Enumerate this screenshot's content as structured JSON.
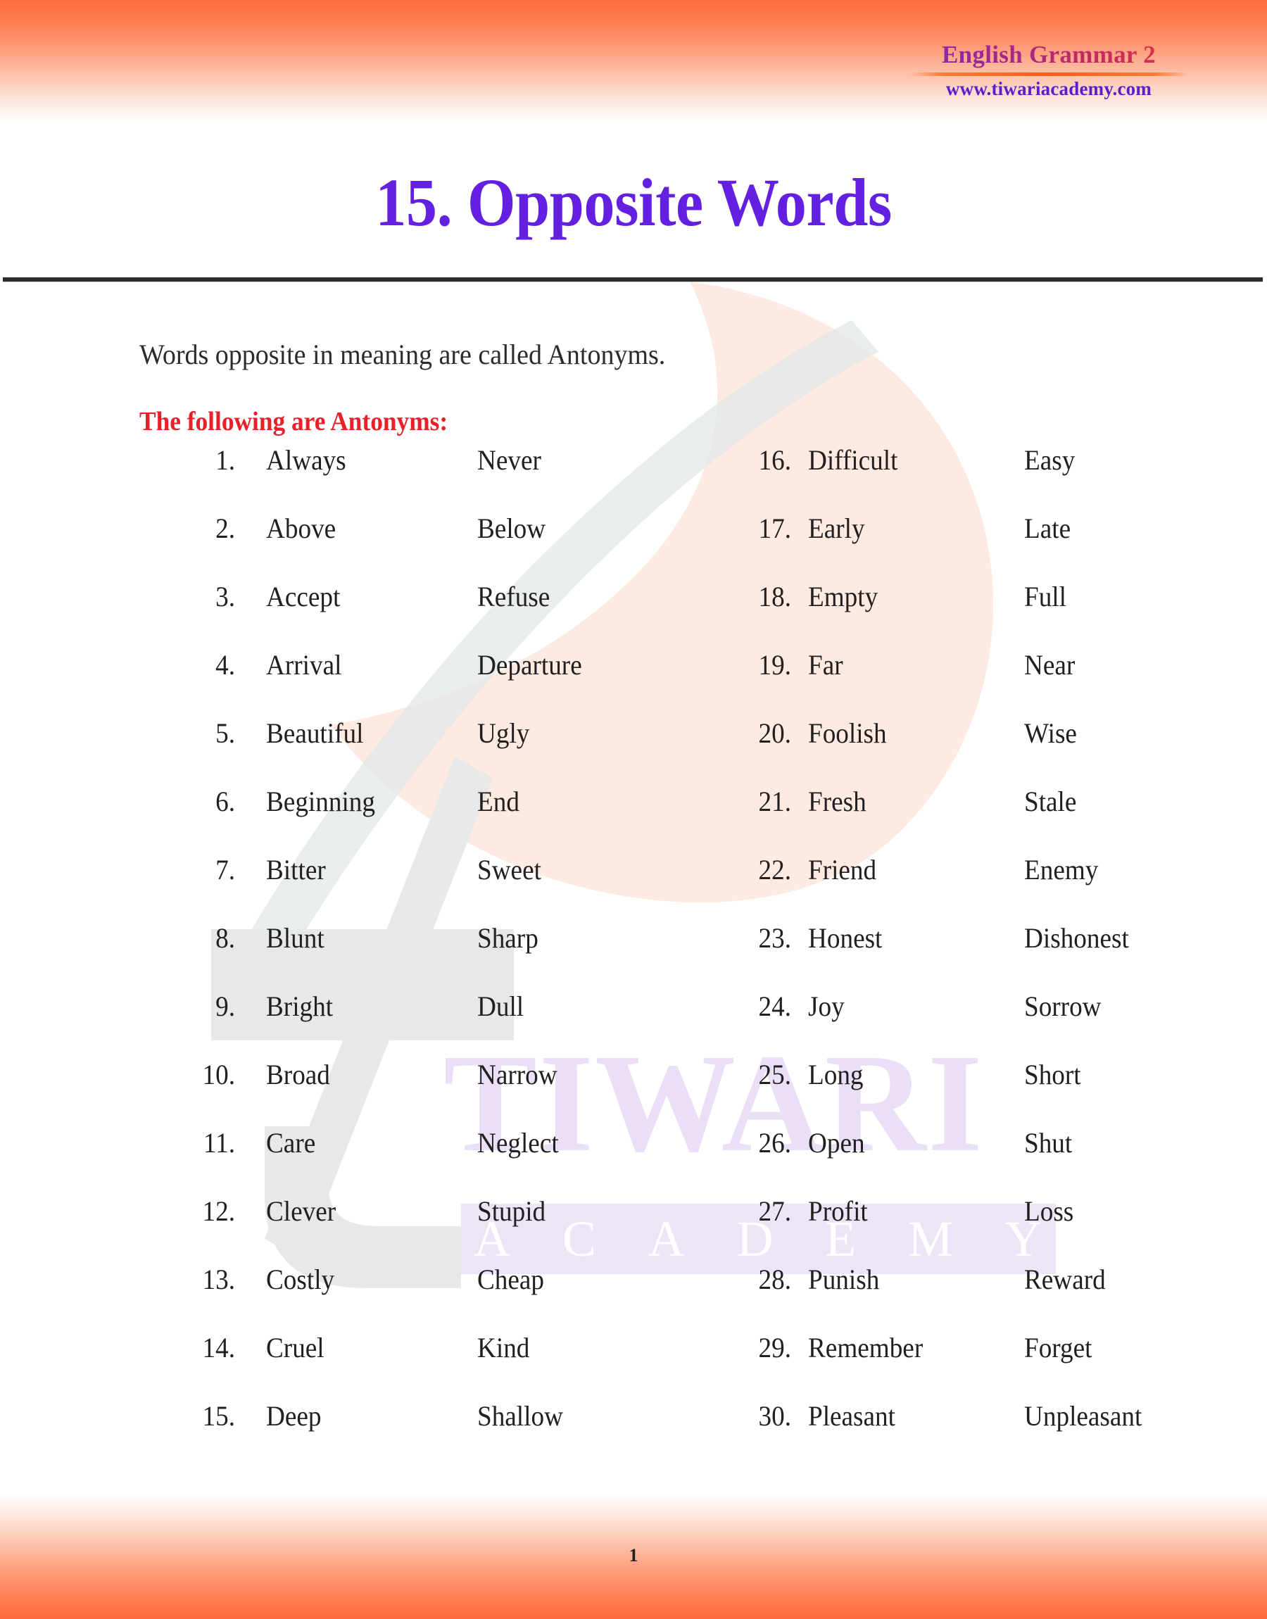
{
  "header": {
    "brand_title": "English Grammar 2",
    "brand_url": "www.tiwariacademy.com"
  },
  "title": "15. Opposite Words",
  "intro": "Words opposite in meaning are called Antonyms.",
  "section_heading": "The following are Antonyms:",
  "footer": {
    "page_number": "1"
  },
  "watermark": {
    "letter": "t",
    "brand": "TIWARI",
    "sub_brand": "ACADEMY",
    "sub_brand_letters": [
      "A",
      "C",
      "A",
      "D",
      "E",
      "M",
      "Y"
    ]
  },
  "colors": {
    "header_orange": "#ff6a3c",
    "title_purple": "#6320e0",
    "section_red": "#e8202a",
    "brand_url_purple": "#5b1ecb",
    "watermark_lavender": "#eadff7",
    "watermark_gray": "#e6e6e6",
    "watermark_peach": "#fdeae0"
  },
  "antonyms": {
    "left_column": [
      {
        "n": "1.",
        "word": "Always",
        "opposite": "Never"
      },
      {
        "n": "2.",
        "word": "Above",
        "opposite": "Below"
      },
      {
        "n": "3.",
        "word": "Accept",
        "opposite": "Refuse"
      },
      {
        "n": "4.",
        "word": "Arrival",
        "opposite": "Departure"
      },
      {
        "n": "5.",
        "word": "Beautiful",
        "opposite": "Ugly"
      },
      {
        "n": "6.",
        "word": "Beginning",
        "opposite": "End"
      },
      {
        "n": "7.",
        "word": "Bitter",
        "opposite": "Sweet"
      },
      {
        "n": "8.",
        "word": "Blunt",
        "opposite": "Sharp"
      },
      {
        "n": "9.",
        "word": "Bright",
        "opposite": "Dull"
      },
      {
        "n": "10.",
        "word": "Broad",
        "opposite": "Narrow"
      },
      {
        "n": "11.",
        "word": "Care",
        "opposite": "Neglect"
      },
      {
        "n": "12.",
        "word": "Clever",
        "opposite": "Stupid"
      },
      {
        "n": "13.",
        "word": "Costly",
        "opposite": "Cheap"
      },
      {
        "n": "14.",
        "word": "Cruel",
        "opposite": "Kind"
      },
      {
        "n": "15.",
        "word": "Deep",
        "opposite": "Shallow"
      }
    ],
    "right_column": [
      {
        "n": "16.",
        "word": "Difficult",
        "opposite": "Easy"
      },
      {
        "n": "17.",
        "word": "Early",
        "opposite": "Late"
      },
      {
        "n": "18.",
        "word": "Empty",
        "opposite": "Full"
      },
      {
        "n": "19.",
        "word": "Far",
        "opposite": "Near"
      },
      {
        "n": "20.",
        "word": "Foolish",
        "opposite": "Wise"
      },
      {
        "n": "21.",
        "word": "Fresh",
        "opposite": "Stale"
      },
      {
        "n": "22.",
        "word": "Friend",
        "opposite": "Enemy"
      },
      {
        "n": "23.",
        "word": "Honest",
        "opposite": "Dishonest"
      },
      {
        "n": "24.",
        "word": "Joy",
        "opposite": "Sorrow"
      },
      {
        "n": "25.",
        "word": "Long",
        "opposite": "Short"
      },
      {
        "n": "26.",
        "word": "Open",
        "opposite": "Shut"
      },
      {
        "n": "27.",
        "word": "Profit",
        "opposite": "Loss"
      },
      {
        "n": "28.",
        "word": "Punish",
        "opposite": "Reward"
      },
      {
        "n": "29.",
        "word": "Remember",
        "opposite": "Forget"
      },
      {
        "n": "30.",
        "word": "Pleasant",
        "opposite": "Unpleasant"
      }
    ]
  }
}
